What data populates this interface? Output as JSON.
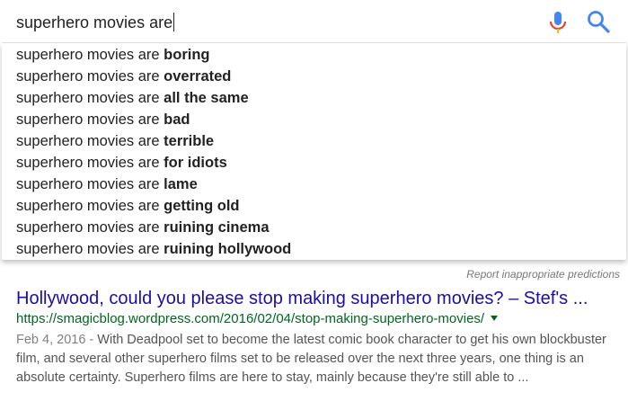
{
  "search": {
    "query": "superhero movies are",
    "prefix": "superhero movies are "
  },
  "icons": {
    "mic": "microphone-icon",
    "search": "search-icon",
    "dropdown": "chevron-down-icon"
  },
  "colors": {
    "mic_blue": "#4285f4",
    "mic_red": "#ea4335",
    "mic_yellow": "#fbbc05",
    "mic_green": "#34a853",
    "link": "#1a0dab",
    "url": "#006621"
  },
  "suggestions": [
    {
      "completion": "boring"
    },
    {
      "completion": "overrated"
    },
    {
      "completion": "all the same"
    },
    {
      "completion": "bad"
    },
    {
      "completion": "terrible"
    },
    {
      "completion": "for idiots"
    },
    {
      "completion": "lame"
    },
    {
      "completion": "getting old"
    },
    {
      "completion": "ruining cinema"
    },
    {
      "completion": "ruining hollywood"
    }
  ],
  "report_link": "Report inappropriate predictions",
  "result": {
    "title": "Hollywood, could you please stop making superhero movies? – Stef's ...",
    "url": "https://smagicblog.wordpress.com/2016/02/04/stop-making-superhero-movies/",
    "date": "Feb 4, 2016 - ",
    "snippet": "With Deadpool set to become the latest comic book character to get his own blockbuster film, and several other superhero films set to be released over the next three years, one thing is an absolute certainty. Superhero films are here to stay, mainly because they're still able to ..."
  }
}
